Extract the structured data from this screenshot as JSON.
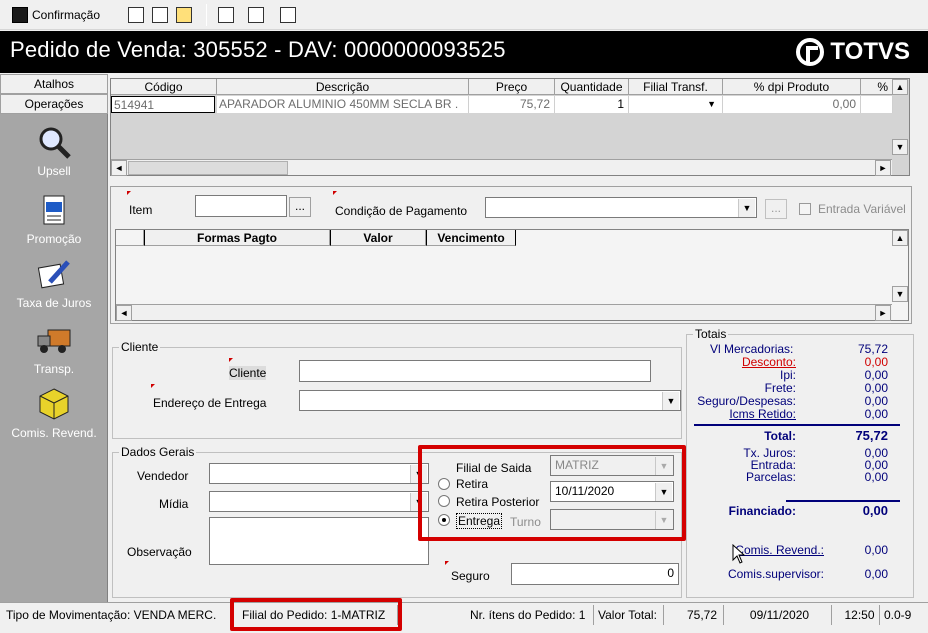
{
  "toolbar": {
    "confirm_label": "Confirmação"
  },
  "header": {
    "title": "Pedido de Venda: 305552  - DAV: 0000000093525",
    "logo_text": "TOTVS"
  },
  "sidebar": {
    "tabs": [
      "Atalhos",
      "Operações"
    ],
    "items": [
      {
        "label": "Upsell",
        "icon": "magnifier-icon"
      },
      {
        "label": "Promoção",
        "icon": "document-icon"
      },
      {
        "label": "Taxa de Juros",
        "icon": "pencil-paper-icon"
      },
      {
        "label": "Transp.",
        "icon": "truck-icon"
      },
      {
        "label": "Comis. Revend.",
        "icon": "cube-icon"
      }
    ]
  },
  "items_grid": {
    "columns": [
      "Código",
      "Descrição",
      "Preço",
      "Quantidade",
      "Filial Transf.",
      "% dpi Produto",
      "%"
    ],
    "row": {
      "codigo": "514941",
      "descricao": "APARADOR ALUMINIO 450MM SECLA  BR .",
      "preco": "75,72",
      "quantidade": "1",
      "filial": "",
      "dpi": "0,00"
    }
  },
  "payment": {
    "item_label": "Item",
    "condicao_label": "Condição de Pagamento",
    "entrada_variavel_label": "Entrada Variável",
    "columns": [
      "Formas Pagto",
      "Valor",
      "Vencimento"
    ],
    "ellipsis": "..."
  },
  "cliente": {
    "group": "Cliente",
    "cliente_label": "Cliente",
    "endereco_label": "Endereço de Entrega"
  },
  "dados": {
    "group": "Dados Gerais",
    "vendedor_label": "Vendedor",
    "midia_label": "Mídia",
    "observacao_label": "Observação",
    "filial_saida_label": "Filial de Saida",
    "filial_saida_value": "MATRIZ",
    "retira_label": "Retira",
    "retira_posterior_label": "Retira Posterior",
    "data_value": "10/11/2020",
    "entrega_label": "Entrega",
    "turno_label": "Turno",
    "seguro_label": "Seguro",
    "seguro_value": "0"
  },
  "totais": {
    "group": "Totais",
    "rows": [
      {
        "label": "Vl Mercadorias:",
        "value": "75,72"
      },
      {
        "label": "Desconto:",
        "value": "0,00"
      },
      {
        "label": "Ipi:",
        "value": "0,00"
      },
      {
        "label": "Frete:",
        "value": "0,00"
      },
      {
        "label": "Seguro/Despesas:",
        "value": "0,00"
      },
      {
        "label": "Icms Retido:",
        "value": "0,00"
      }
    ],
    "total_label": "Total:",
    "total_value": "75,72",
    "rows2": [
      {
        "label": "Tx. Juros:",
        "value": "0,00"
      },
      {
        "label": "Entrada:",
        "value": "0,00"
      },
      {
        "label": "Parcelas:",
        "value": "0,00"
      }
    ],
    "financiado_label": "Financiado:",
    "financiado_value": "0,00",
    "comis_revend_label": "Comis. Revend.:",
    "comis_revend_value": "0,00",
    "comis_sup_label": "Comis.supervisor:",
    "comis_sup_value": "0,00"
  },
  "status": {
    "movimentacao": "Tipo de Movimentação: VENDA MERC.",
    "filial_pedido": "Filial do Pedido: 1-MATRIZ",
    "itens": "Nr. ítens do Pedido: 1",
    "valor_total_label": "Valor Total:",
    "valor_total": "75,72",
    "date": "09/11/2020",
    "time": "12:50",
    "extra": "0.0-9"
  },
  "colors": {
    "highlight": "#d40000",
    "totals_text": "#00007a",
    "desconto": "#d00000",
    "sidebar_bg": "#a6a6a6"
  }
}
